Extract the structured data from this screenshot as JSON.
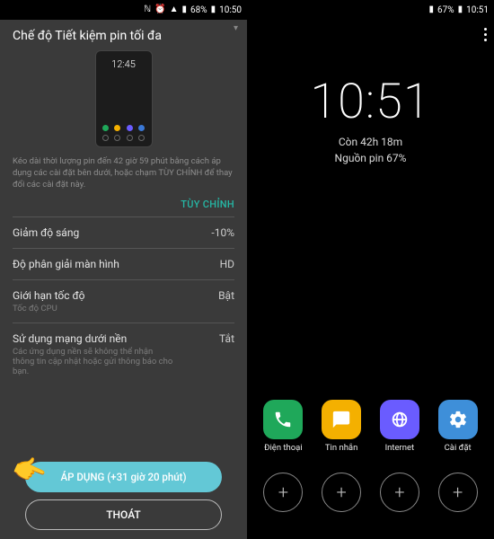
{
  "left": {
    "status": {
      "battery": "68%",
      "time": "10:50"
    },
    "title": "Chế độ Tiết kiệm pin tối đa",
    "preview_time": "12:45",
    "description": "Kéo dài thời lượng pin đến 42 giờ 59 phút bằng cách áp dụng các cài đặt bên dưới, hoặc chạm TÙY CHỈNH để thay đổi các cài đặt này.",
    "customize": "TÙY CHỈNH",
    "settings": {
      "brightness": {
        "label": "Giảm độ sáng",
        "value": "-10%"
      },
      "resolution": {
        "label": "Độ phân giải màn hình",
        "value": "HD"
      },
      "speed": {
        "label": "Giới hạn tốc độ",
        "value": "Bật",
        "sub": "Tốc độ CPU"
      },
      "background": {
        "label": "Sử dụng mạng dưới nền",
        "value": "Tắt",
        "sub": "Các ứng dụng nền sẽ không thể nhận thông tin cập nhật hoặc gửi thông báo cho bạn."
      }
    },
    "apply": "ÁP DỤNG (+31 giờ 20 phút)",
    "exit": "THOÁT"
  },
  "right": {
    "status": {
      "battery": "67%",
      "time": "10:51"
    },
    "clock": "10:51",
    "remain": "Còn 42h 18m",
    "battery_line": "Nguồn pin 67%",
    "apps": {
      "phone": "Điện thoại",
      "messages": "Tin nhắn",
      "internet": "Internet",
      "settings": "Cài đặt"
    }
  }
}
